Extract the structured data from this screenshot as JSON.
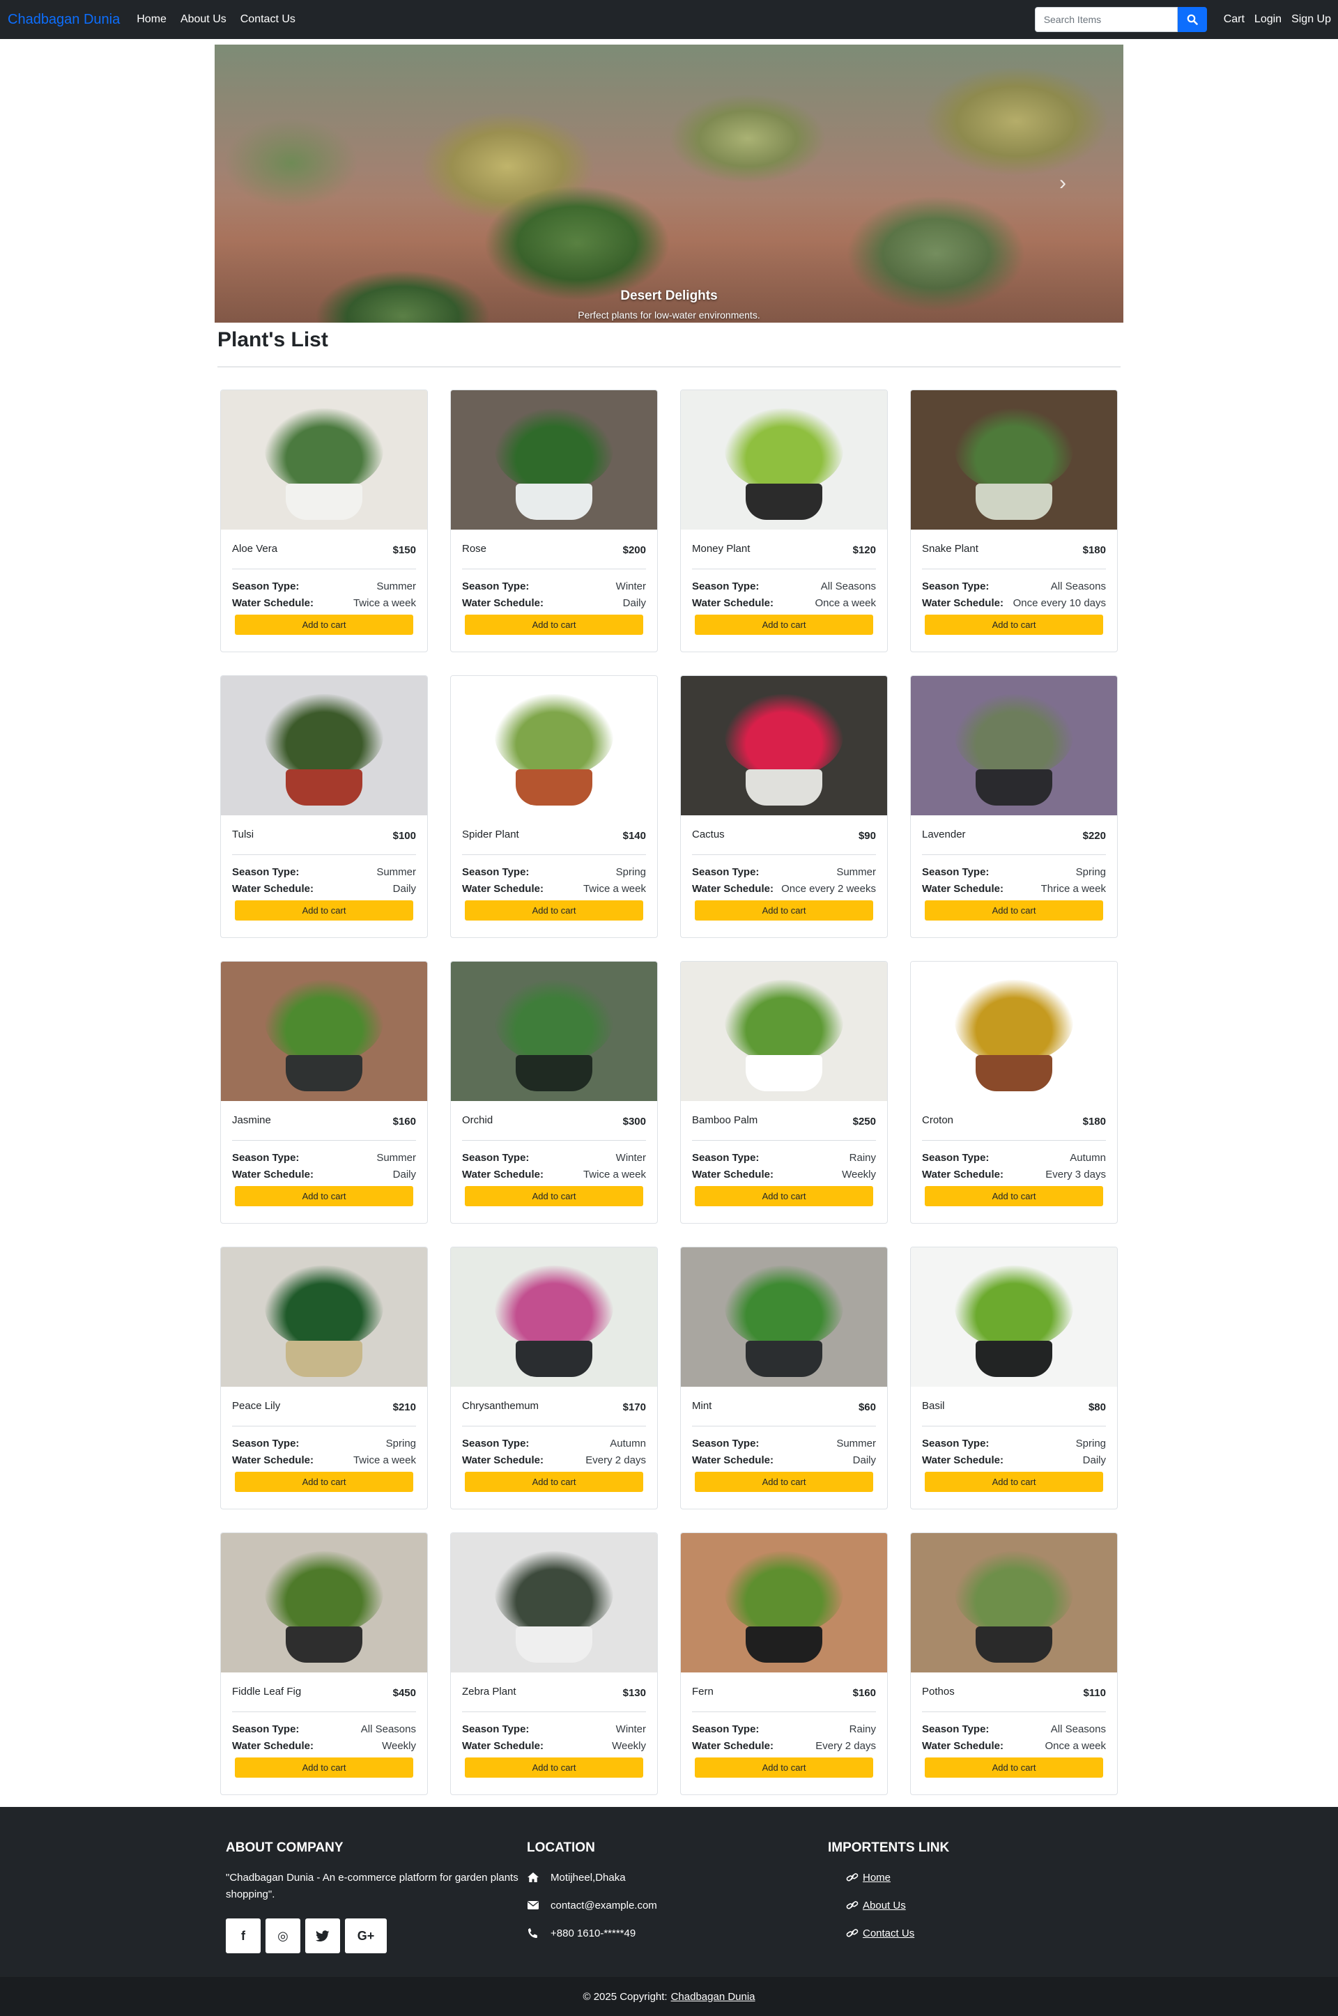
{
  "nav": {
    "brand": "Chadbagan Dunia",
    "links": [
      "Home",
      "About Us",
      "Contact Us"
    ],
    "search_placeholder": "Search Items",
    "right_links": [
      "Cart",
      "Login",
      "Sign Up"
    ]
  },
  "carousel": {
    "title": "Desert Delights",
    "text": "Perfect plants for low-water environments.",
    "next_glyph": "›"
  },
  "section": {
    "title": "Plant's List"
  },
  "labels": {
    "season": "Season Type:",
    "water": "Water Schedule:",
    "add": "Add to cart"
  },
  "plants": [
    {
      "name": "Aloe Vera",
      "price": "$150",
      "season": "Summer",
      "water": "Twice a week",
      "bg": "#e9e6e0",
      "pot": "#f2f2ef",
      "leaf": "#4b7a3f"
    },
    {
      "name": "Rose",
      "price": "$200",
      "season": "Winter",
      "water": "Daily",
      "bg": "#6b6158",
      "pot": "#e8ecec",
      "leaf": "#2f6a2a"
    },
    {
      "name": "Money Plant",
      "price": "$120",
      "season": "All Seasons",
      "water": "Once a week",
      "bg": "#eef0ee",
      "pot": "#2b2b2b",
      "leaf": "#8fbf3f"
    },
    {
      "name": "Snake Plant",
      "price": "$180",
      "season": "All Seasons",
      "water": "Once every 10 days",
      "bg": "#5a4634",
      "pot": "#cfd4c4",
      "leaf": "#4e7a3a"
    },
    {
      "name": "Tulsi",
      "price": "$100",
      "season": "Summer",
      "water": "Daily",
      "bg": "#d9d9dc",
      "pot": "#a63a2c",
      "leaf": "#3c5a2a"
    },
    {
      "name": "Spider Plant",
      "price": "$140",
      "season": "Spring",
      "water": "Twice a week",
      "bg": "#ffffff",
      "pot": "#b5552f",
      "leaf": "#7fa64a"
    },
    {
      "name": "Cactus",
      "price": "$90",
      "season": "Summer",
      "water": "Once every 2 weeks",
      "bg": "#3c3a36",
      "pot": "#e0e0dc",
      "leaf": "#d9204a"
    },
    {
      "name": "Lavender",
      "price": "$220",
      "season": "Spring",
      "water": "Thrice a week",
      "bg": "#7e6f8e",
      "pot": "#2a2a2e",
      "leaf": "#6d7d5c"
    },
    {
      "name": "Jasmine",
      "price": "$160",
      "season": "Summer",
      "water": "Daily",
      "bg": "#9c7058",
      "pot": "#2f3232",
      "leaf": "#4d8a2f"
    },
    {
      "name": "Orchid",
      "price": "$300",
      "season": "Winter",
      "water": "Twice a week",
      "bg": "#5d6e57",
      "pot": "#1f2a22",
      "leaf": "#3f7d3a"
    },
    {
      "name": "Bamboo Palm",
      "price": "$250",
      "season": "Rainy",
      "water": "Weekly",
      "bg": "#ecebe6",
      "pot": "#ffffff",
      "leaf": "#5e9a35"
    },
    {
      "name": "Croton",
      "price": "$180",
      "season": "Autumn",
      "water": "Every 3 days",
      "bg": "#ffffff",
      "pot": "#8a4a2a",
      "leaf": "#c59a1f"
    },
    {
      "name": "Peace Lily",
      "price": "$210",
      "season": "Spring",
      "water": "Twice a week",
      "bg": "#d6d3cc",
      "pot": "#c7b78a",
      "leaf": "#1f5a2a"
    },
    {
      "name": "Chrysanthemum",
      "price": "$170",
      "season": "Autumn",
      "water": "Every 2 days",
      "bg": "#e7ebe6",
      "pot": "#2a2d30",
      "leaf": "#c24f8f"
    },
    {
      "name": "Mint",
      "price": "$60",
      "season": "Summer",
      "water": "Daily",
      "bg": "#a9a6a0",
      "pot": "#2b2e30",
      "leaf": "#3e8a32"
    },
    {
      "name": "Basil",
      "price": "$80",
      "season": "Spring",
      "water": "Daily",
      "bg": "#f4f5f4",
      "pot": "#222424",
      "leaf": "#6caa2e"
    },
    {
      "name": "Fiddle Leaf Fig",
      "price": "$450",
      "season": "All Seasons",
      "water": "Weekly",
      "bg": "#c9c3b8",
      "pot": "#2e2e2e",
      "leaf": "#4e7a2a"
    },
    {
      "name": "Zebra Plant",
      "price": "$130",
      "season": "Winter",
      "water": "Weekly",
      "bg": "#e3e3e3",
      "pot": "#efefef",
      "leaf": "#3d4a3c"
    },
    {
      "name": "Fern",
      "price": "$160",
      "season": "Rainy",
      "water": "Every 2 days",
      "bg": "#c08a64",
      "pot": "#1f1f1f",
      "leaf": "#5e8f2f"
    },
    {
      "name": "Pothos",
      "price": "$110",
      "season": "All Seasons",
      "water": "Once a week",
      "bg": "#a88a6a",
      "pot": "#2a2a2a",
      "leaf": "#6e8f4a"
    }
  ],
  "footer": {
    "about_title": "ABOUT COMPANY",
    "about_text": "\"Chadbagan Dunia - An e-commerce platform for garden plants shopping\".",
    "social": [
      {
        "icon": "facebook-icon",
        "glyph": "f"
      },
      {
        "icon": "dribbble-icon",
        "glyph": "◎"
      },
      {
        "icon": "twitter-icon",
        "glyph": "🐦"
      },
      {
        "icon": "google-plus-icon",
        "glyph": "G+"
      }
    ],
    "location_title": "LOCATION",
    "address": "Motijheel,Dhaka",
    "email": "contact@example.com",
    "phone": "+880 1610-*****49",
    "links_title": "IMPORTENTS LINK",
    "links": [
      "Home",
      "About Us",
      "Contact Us"
    ]
  },
  "copyright": {
    "prefix": "© 2025 Copyright:",
    "link": "Chadbagan Dunia"
  }
}
